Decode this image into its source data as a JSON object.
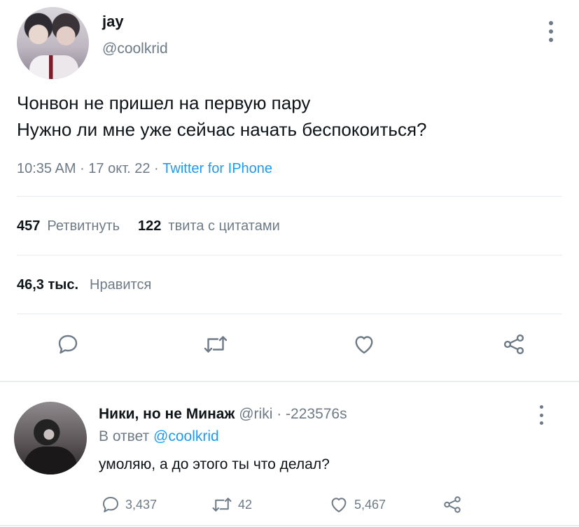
{
  "tweet": {
    "name": "jay",
    "handle": "@coolkrid",
    "text_line1": "Чонвон не пришел на первую пару",
    "text_line2": "Нужно ли мне уже сейчас начать беспокоиться?",
    "time": "10:35 AM",
    "dot1": " · ",
    "date": "17 окт. 22",
    "dot2": " · ",
    "source": "Twitter for IPhone",
    "retweets_count": "457",
    "retweets_label": "Ретвитнуть",
    "quotes_count": "122",
    "quotes_label": "твита с цитатами",
    "likes_count": "46,3 тыс.",
    "likes_label": "Нравится",
    "icons": [
      "reply-icon",
      "retweet-icon",
      "like-icon",
      "share-icon",
      "more-icon"
    ]
  },
  "reply": {
    "name": "Ники, но не Минаж",
    "handle": "@riki",
    "separator": " · ",
    "time": "-223576s",
    "in_reply_prefix": "В ответ ",
    "in_reply_mention": "@coolkrid",
    "text": "умоляю, а до этого ты что делал?",
    "reply_count": "3,437",
    "retweet_count": "42",
    "like_count": "5,467"
  },
  "colors": {
    "text": "#0f1419",
    "secondary": "#6e7b86",
    "accent": "#1d9bf0",
    "divider": "#e6ecf0"
  }
}
